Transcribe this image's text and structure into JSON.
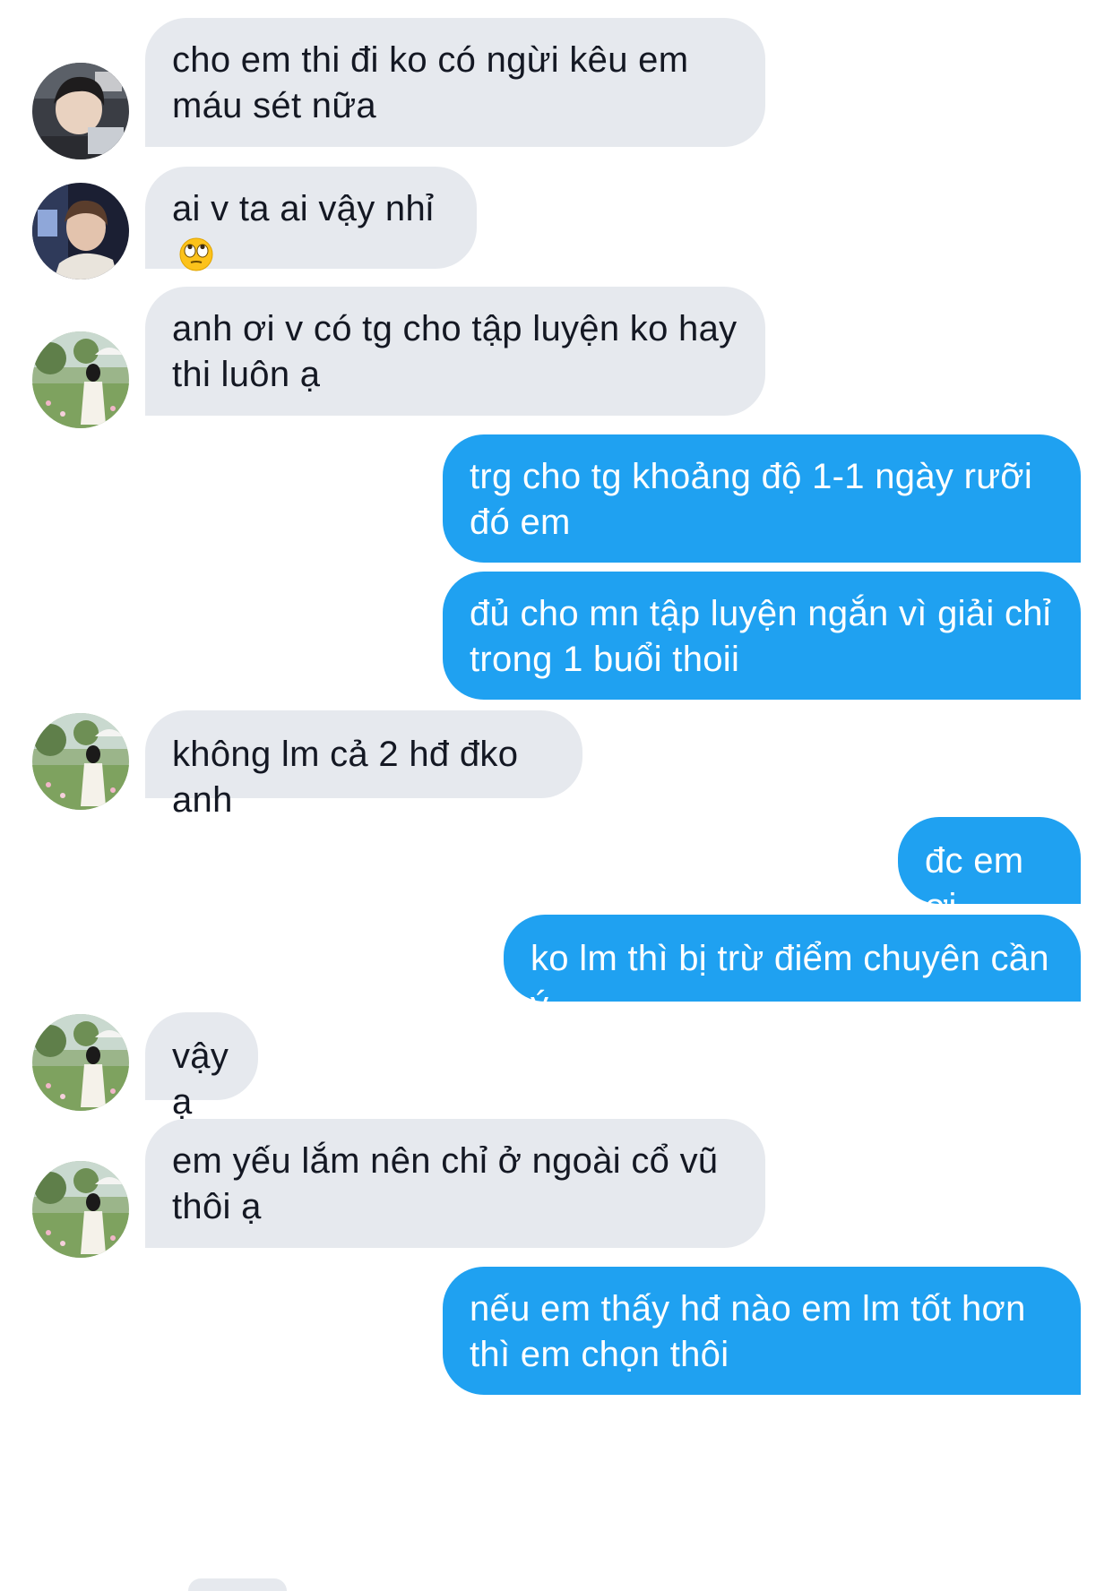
{
  "conversation": {
    "messages": [
      {
        "sender": "other",
        "avatar": "avatar-gamer-boy",
        "text": "cho em thi đi ko có ngừi kêu em máu sét nữa"
      },
      {
        "sender": "other",
        "avatar": "avatar-boy-headphones",
        "text": "ai v ta ai vậy nhỉ",
        "emoji": "eye-roll-emoji"
      },
      {
        "sender": "other",
        "avatar": "avatar-girl-umbrella",
        "text": "anh ơi v có tg cho tập luyện ko hay thi luôn ạ"
      },
      {
        "sender": "me",
        "text": "trg cho tg khoảng độ 1-1 ngày rưỡi đó em"
      },
      {
        "sender": "me",
        "text": "đủ cho mn tập luyện ngắn vì giải chỉ trong 1 buổi thoii"
      },
      {
        "sender": "other",
        "avatar": "avatar-girl-umbrella",
        "text": "không lm cả 2 hđ đko anh"
      },
      {
        "sender": "me",
        "text": "đc em ơi"
      },
      {
        "sender": "me",
        "text": "ko lm thì bị trừ điểm chuyên cần ý"
      },
      {
        "sender": "other",
        "avatar": "avatar-girl-umbrella",
        "text": "vậy ạ"
      },
      {
        "sender": "other",
        "avatar": "avatar-girl-umbrella",
        "text": "em yếu lắm nên chỉ ở ngoài cổ vũ thôi ạ"
      },
      {
        "sender": "me",
        "text": "nếu em thấy hđ nào em lm tốt hơn thì em chọn thôi"
      }
    ]
  },
  "colors": {
    "incoming_bubble": "#e6e9ee",
    "outgoing_bubble": "#1fa1f1",
    "incoming_text": "#141823",
    "outgoing_text": "#ffffff"
  }
}
